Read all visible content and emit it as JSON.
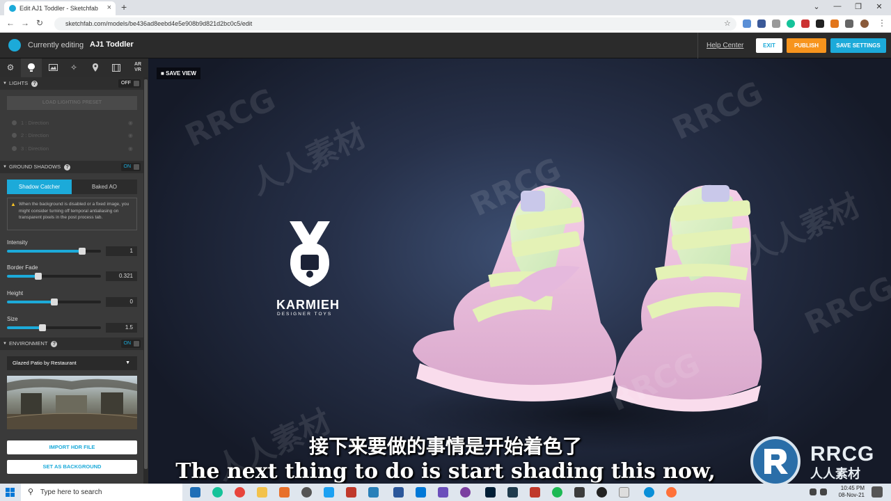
{
  "browser": {
    "tab_title": "Edit AJ1 Toddler - Sketchfab",
    "tab_close": "×",
    "new_tab": "+",
    "url": "sketchfab.com/models/be436ad8eebd4e5e908b9d821d2bc0c5/edit",
    "window_controls": [
      "⌄",
      "—",
      "❐",
      "✕"
    ]
  },
  "header": {
    "editing_label": "Currently editing",
    "model_name": "AJ1 Toddler",
    "help": "Help Center",
    "exit": "EXIT",
    "publish": "PUBLISH",
    "save_settings": "SAVE SETTINGS"
  },
  "toolbar": {
    "tools": [
      "gear-icon",
      "light-icon",
      "image-icon",
      "wand-icon",
      "pin-icon",
      "film-icon",
      "ar-vr-icon"
    ],
    "ar_label": "AR\nVR"
  },
  "lights": {
    "title": "LIGHTS",
    "toggle": "OFF",
    "load_preset": "LOAD LIGHTING PRESET",
    "items": [
      "1 : Direction",
      "2 : Direction",
      "3 : Direction"
    ]
  },
  "ground_shadows": {
    "title": "GROUND SHADOWS",
    "toggle": "ON",
    "tabs": [
      "Shadow Catcher",
      "Baked AO"
    ],
    "active_tab": "Shadow Catcher",
    "warning": "When the background is disabled or a fixed image, you might consider turning off temporal antialiasing on transparent pixels in the post process tab.",
    "sliders": [
      {
        "label": "Intensity",
        "value": "1",
        "fraction": 0.8
      },
      {
        "label": "Border Fade",
        "value": "0.321",
        "fraction": 0.33
      },
      {
        "label": "Height",
        "value": "0",
        "fraction": 0.5
      },
      {
        "label": "Size",
        "value": "1.5",
        "fraction": 0.38
      }
    ]
  },
  "environment": {
    "title": "ENVIRONMENT",
    "toggle": "ON",
    "selected": "Glazed Patio by Restaurant",
    "import_hdr": "IMPORT HDR FILE",
    "set_background": "SET AS BACKGROUND"
  },
  "viewport": {
    "save_view": "SAVE VIEW",
    "brand": "KARMIEH",
    "brand_sub": "DESIGNER TOYS",
    "watermark": "RRCG",
    "watermark_cn": "人人素材"
  },
  "subtitles": {
    "cn": "接下来要做的事情是开始着色了",
    "en": "The next thing to do is start shading this now,"
  },
  "logo": {
    "text": "RRCG",
    "cn": "人人素材"
  },
  "taskbar": {
    "search": "Type here to search",
    "time": "10:45 PM",
    "date": "08-Nov-21"
  },
  "colors": {
    "accent": "#1caad9",
    "publish": "#f7941d",
    "panel": "#3a3a3a"
  }
}
